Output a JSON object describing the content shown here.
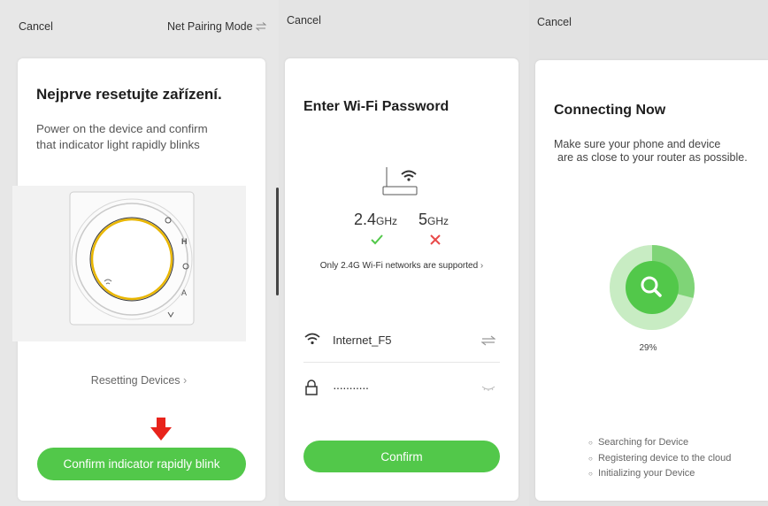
{
  "panel1": {
    "cancel": "Cancel",
    "mode_label": "Net Pairing Mode",
    "mode_icon": "switch-arrows-icon",
    "title": "Nejprve resetujte zařízení.",
    "desc_line1": "Power on the device and confirm",
    "desc_line2": "that indicator light rapidly blinks",
    "device_labels": [
      "H",
      "A"
    ],
    "link": "Resetting Devices",
    "button": "Confirm indicator rapidly blink",
    "arrow_color": "#e8231b"
  },
  "panel2": {
    "cancel": "Cancel",
    "title": "Enter Wi-Fi Password",
    "band_24": "2.4",
    "band_24_unit": "GHz",
    "band_5": "5",
    "band_5_unit": "GHz",
    "band_24_status": "check-icon",
    "band_5_status": "cross-icon",
    "notice": "Only 2.4G Wi-Fi networks are supported",
    "ssid": "Internet_F5",
    "password": "···········",
    "button": "Confirm"
  },
  "panel3": {
    "cancel": "Cancel",
    "title": "Connecting Now",
    "desc_line1": "Make sure your phone and device",
    "desc_line2": "are as close to your router as possible.",
    "progress": 29,
    "progress_label": "29%",
    "steps": [
      "Searching for Device",
      "Registering device to the cloud",
      "Initializing your Device"
    ]
  },
  "colors": {
    "accent": "#52c84a",
    "error": "#e84a4a",
    "light_green": "#bfe8b9"
  }
}
